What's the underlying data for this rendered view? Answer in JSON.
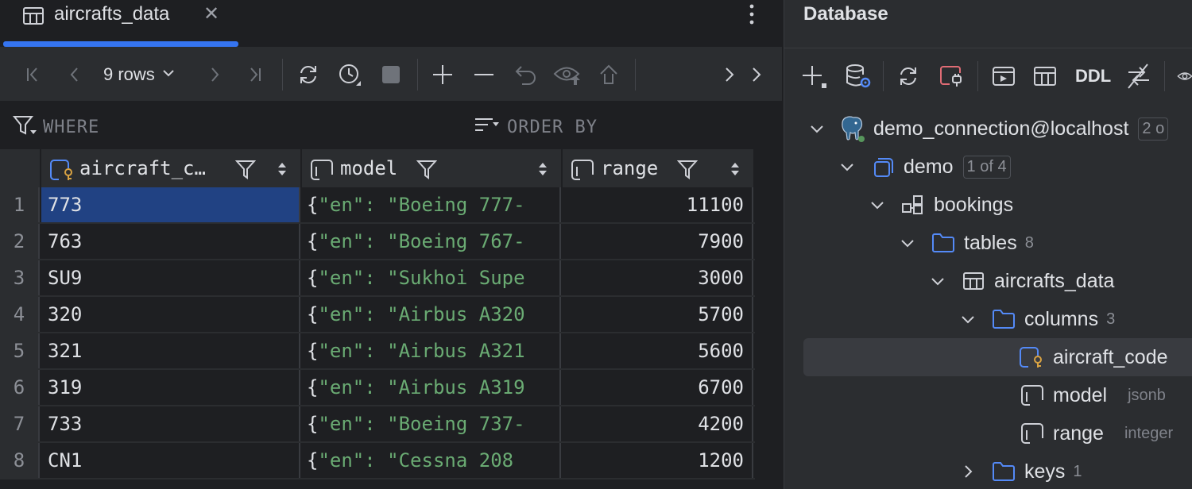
{
  "editor": {
    "tab_title": "aircrafts_data",
    "rows_label": "9 rows"
  },
  "filters": {
    "where_label": "WHERE",
    "order_by_label": "ORDER BY"
  },
  "grid": {
    "columns": [
      "aircraft_c…",
      "model",
      "range"
    ],
    "selected_cell": {
      "row": 1,
      "column": "aircraft_code"
    },
    "rows": [
      {
        "n": "1",
        "code": "773",
        "model": "\"en\": \"Boeing 777-",
        "range": "11100"
      },
      {
        "n": "2",
        "code": "763",
        "model": "\"en\": \"Boeing 767-",
        "range": "7900"
      },
      {
        "n": "3",
        "code": "SU9",
        "model": "\"en\": \"Sukhoi Supe",
        "range": "3000"
      },
      {
        "n": "4",
        "code": "320",
        "model": "\"en\": \"Airbus A320",
        "range": "5700"
      },
      {
        "n": "5",
        "code": "321",
        "model": "\"en\": \"Airbus A321",
        "range": "5600"
      },
      {
        "n": "6",
        "code": "319",
        "model": "\"en\": \"Airbus A319",
        "range": "6700"
      },
      {
        "n": "7",
        "code": "733",
        "model": "\"en\": \"Boeing 737-",
        "range": "4200"
      },
      {
        "n": "8",
        "code": "CN1",
        "model": "\"en\": \"Cessna 208",
        "range": "1200"
      }
    ]
  },
  "database": {
    "title": "Database",
    "ddl_label": "DDL",
    "tree": [
      {
        "label": "demo_connection@localhost",
        "badge": "2 o"
      },
      {
        "label": "demo",
        "badge": "1 of 4"
      },
      {
        "label": "bookings"
      },
      {
        "label": "tables",
        "count": "8"
      },
      {
        "label": "aircrafts_data"
      },
      {
        "label": "columns",
        "count": "3"
      },
      {
        "label": "aircraft_code"
      },
      {
        "label": "model",
        "type": "jsonb"
      },
      {
        "label": "range",
        "type": "integer"
      },
      {
        "label": "keys",
        "count": "1"
      }
    ]
  },
  "colors": {
    "accent": "#3574f0",
    "selection": "#214283",
    "string": "#6aab73",
    "background": "#1e1f22",
    "panel": "#2b2d30"
  }
}
